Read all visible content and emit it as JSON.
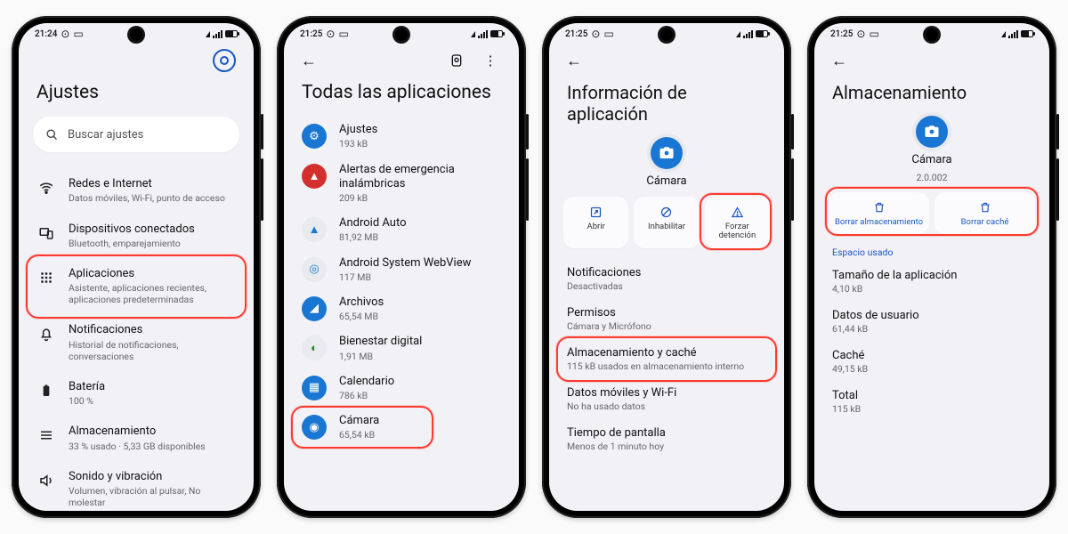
{
  "status": {
    "time1": "21:24",
    "time2": "21:25",
    "dot": "⊙",
    "card": "▭"
  },
  "s1": {
    "title": "Ajustes",
    "search": "Buscar ajustes",
    "items": [
      {
        "icon": "wifi",
        "title": "Redes e Internet",
        "sub": "Datos móviles, Wi-Fi, punto de acceso"
      },
      {
        "icon": "devices",
        "title": "Dispositivos conectados",
        "sub": "Bluetooth, emparejamiento"
      },
      {
        "icon": "apps",
        "title": "Aplicaciones",
        "sub": "Asistente, aplicaciones recientes, aplicaciones predeterminadas"
      },
      {
        "icon": "notif",
        "title": "Notificaciones",
        "sub": "Historial de notificaciones, conversaciones"
      },
      {
        "icon": "battery",
        "title": "Batería",
        "sub": "100 %"
      },
      {
        "icon": "storage",
        "title": "Almacenamiento",
        "sub": "33 % usado · 5,33 GB disponibles"
      },
      {
        "icon": "sound",
        "title": "Sonido y vibración",
        "sub": "Volumen, vibración al pulsar, No molestar"
      }
    ]
  },
  "s2": {
    "title": "Todas las aplicaciones",
    "apps": [
      {
        "name": "Ajustes",
        "size": "193 kB",
        "color": "#1976d2",
        "glyph": "⚙"
      },
      {
        "name": "Alertas de emergencia inalámbricas",
        "size": "209 kB",
        "color": "#d32f2f",
        "glyph": "▲"
      },
      {
        "name": "Android Auto",
        "size": "81,92 MB",
        "color": "#e8eaed",
        "glyph": "▲",
        "fg": "#1976d2"
      },
      {
        "name": "Android System WebView",
        "size": "117 MB",
        "color": "#e8eaed",
        "glyph": "◎",
        "fg": "#1976d2"
      },
      {
        "name": "Archivos",
        "size": "65,54 MB",
        "color": "#1976d2",
        "glyph": "◢"
      },
      {
        "name": "Bienestar digital",
        "size": "1,91 MB",
        "color": "#e8eaed",
        "glyph": "◐",
        "fg": "#2e7d32"
      },
      {
        "name": "Calendario",
        "size": "786 kB",
        "color": "#1976d2",
        "glyph": "▦"
      },
      {
        "name": "Cámara",
        "size": "65,54 kB",
        "color": "#1976d2",
        "glyph": "◉"
      }
    ]
  },
  "s3": {
    "title": "Información de aplicación",
    "app_name": "Cámara",
    "actions": [
      {
        "icon": "↗",
        "label": "Abrir"
      },
      {
        "icon": "⊘",
        "label": "Inhabilitar"
      },
      {
        "icon": "△",
        "label": "Forzar detención"
      }
    ],
    "rows": [
      {
        "title": "Notificaciones",
        "sub": "Desactivadas"
      },
      {
        "title": "Permisos",
        "sub": "Cámara y Micrófono"
      },
      {
        "title": "Almacenamiento y caché",
        "sub": "115 kB usados en almacenamiento interno"
      },
      {
        "title": "Datos móviles y Wi-Fi",
        "sub": "No ha usado datos"
      },
      {
        "title": "Tiempo de pantalla",
        "sub": "Menos de 1 minuto hoy"
      }
    ]
  },
  "s4": {
    "title": "Almacenamiento",
    "app_name": "Cámara",
    "app_version": "2.0.002",
    "clear": [
      {
        "label": "Borrar almacenamiento"
      },
      {
        "label": "Borrar caché"
      }
    ],
    "section": "Espacio usado",
    "rows": [
      {
        "title": "Tamaño de la aplicación",
        "sub": "4,10 kB"
      },
      {
        "title": "Datos de usuario",
        "sub": "61,44 kB"
      },
      {
        "title": "Caché",
        "sub": "49,15 kB"
      },
      {
        "title": "Total",
        "sub": "115 kB"
      }
    ]
  }
}
